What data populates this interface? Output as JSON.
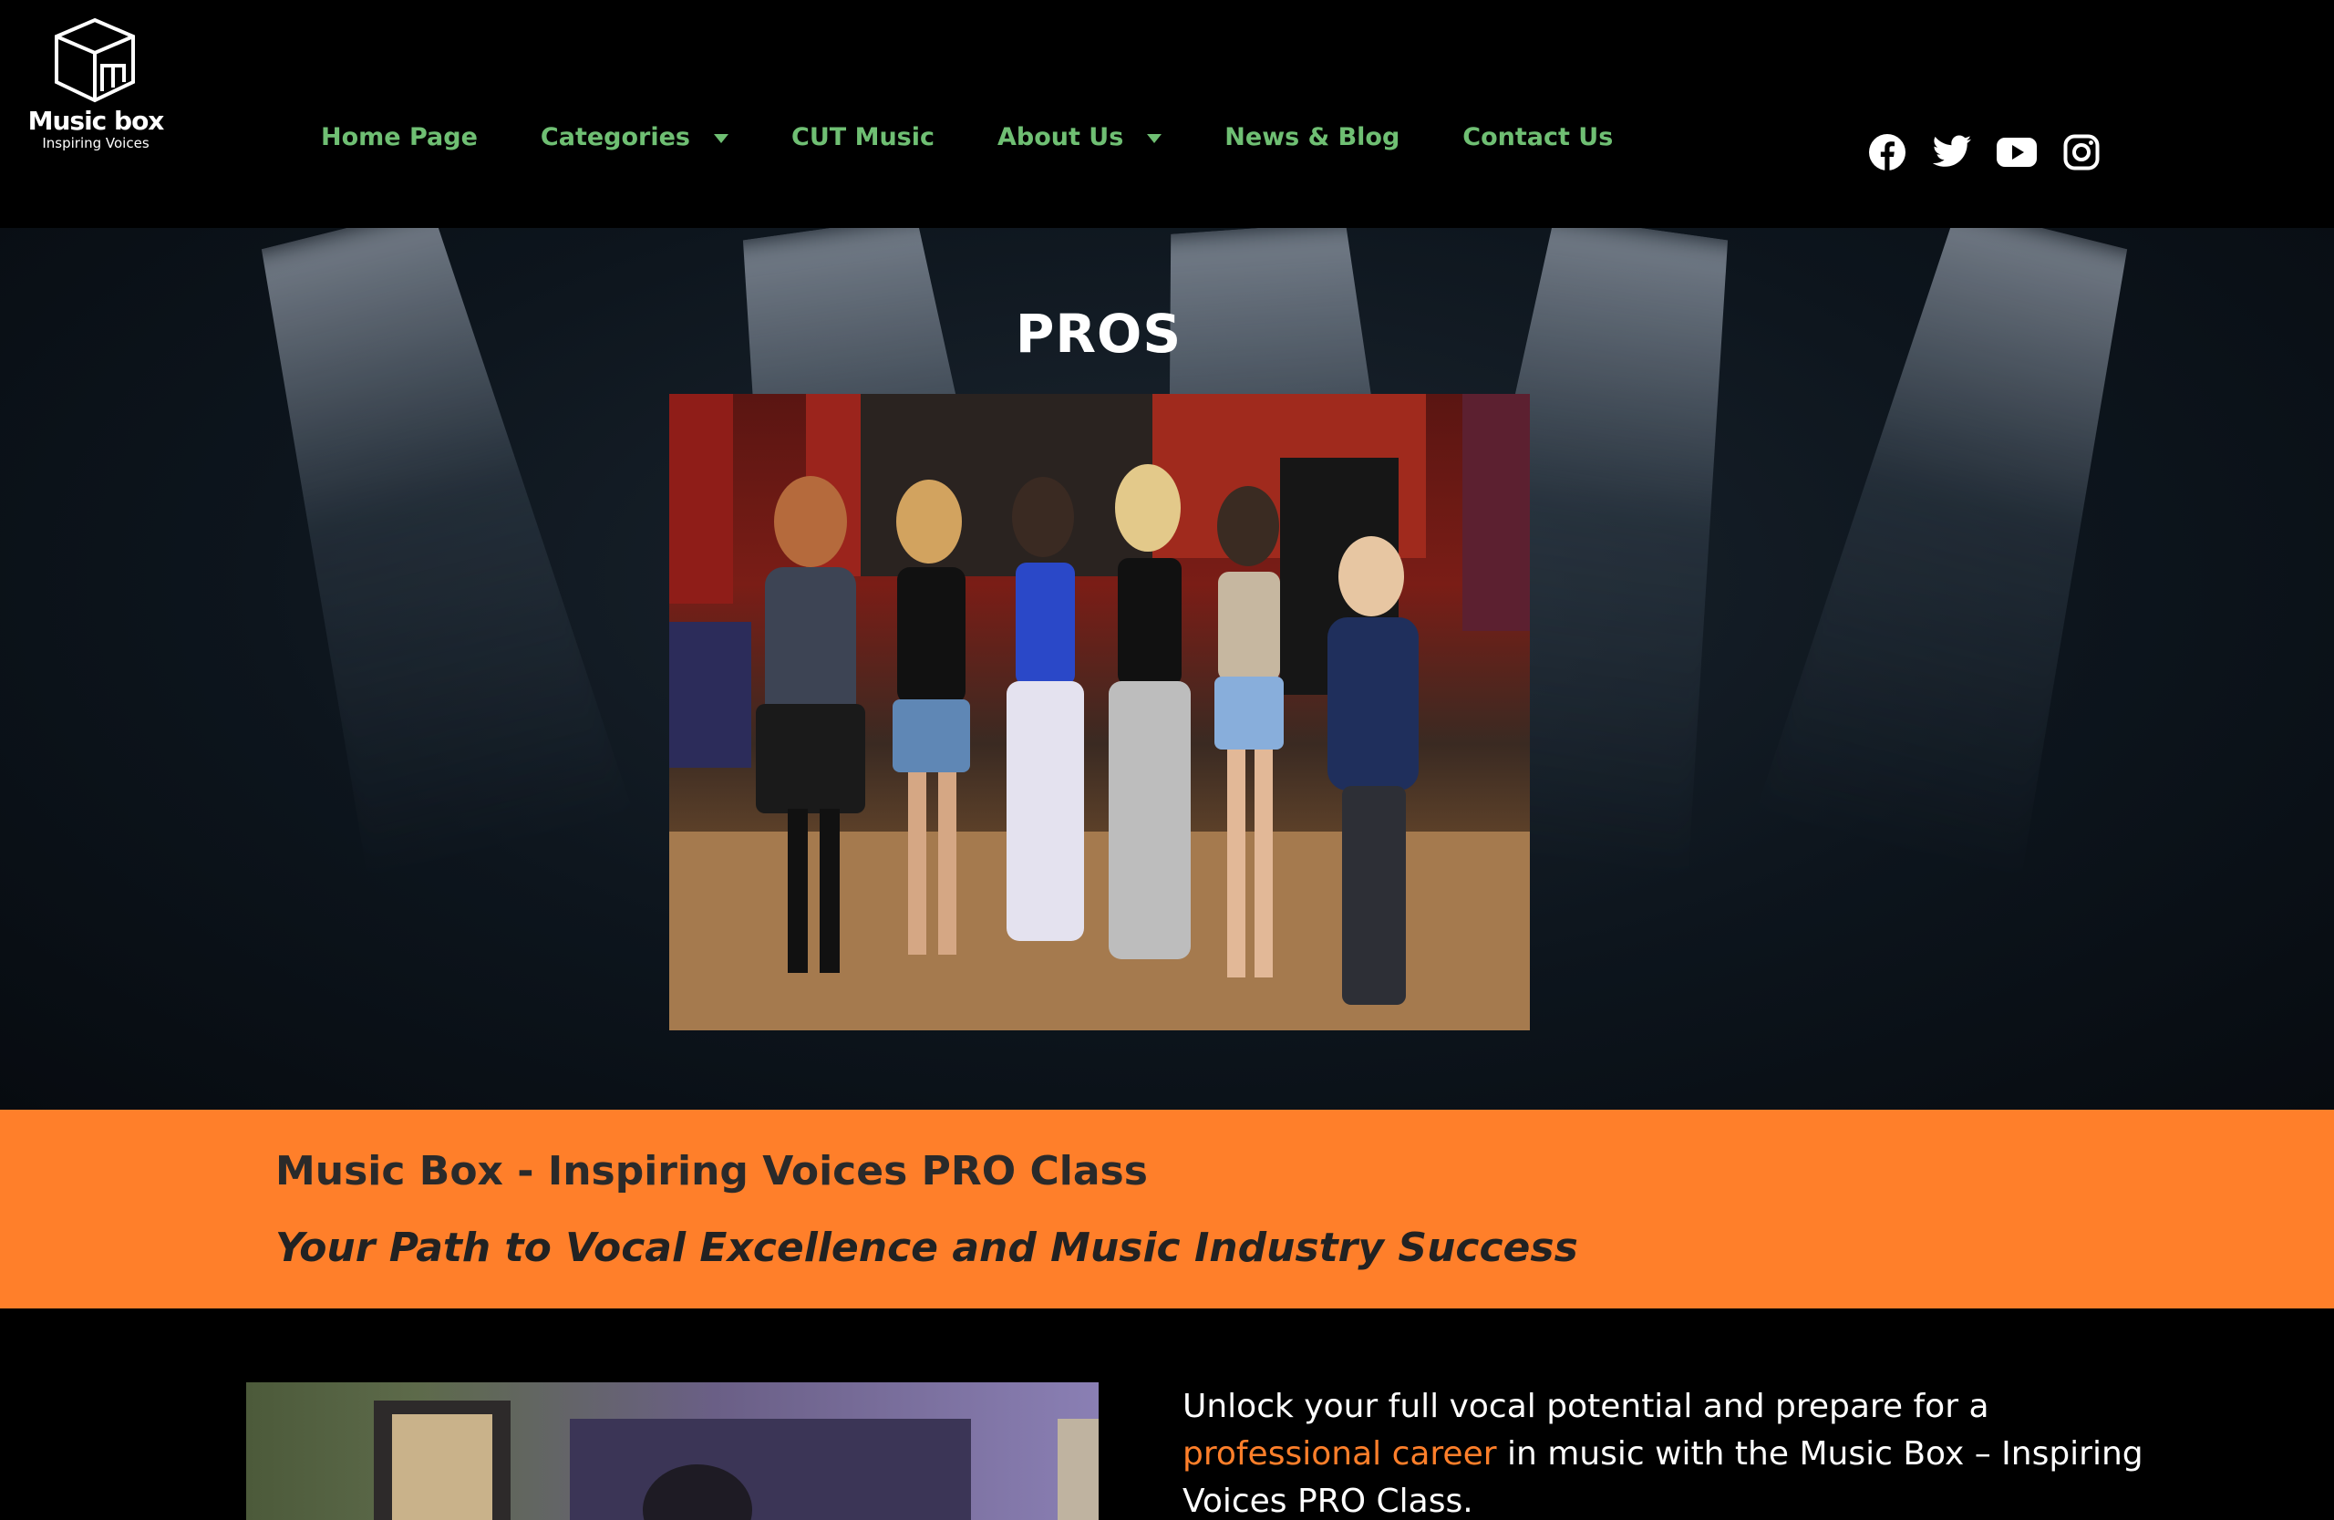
{
  "logo": {
    "brand": "Music box",
    "tagline": "Inspiring Voices"
  },
  "nav": {
    "items": [
      {
        "label": "Home Page",
        "dropdown": false
      },
      {
        "label": "Categories",
        "dropdown": true
      },
      {
        "label": "CUT Music",
        "dropdown": false
      },
      {
        "label": "About Us",
        "dropdown": true
      },
      {
        "label": "News & Blog",
        "dropdown": false
      },
      {
        "label": "Contact Us",
        "dropdown": false
      }
    ],
    "color": "#6fbf73"
  },
  "social": {
    "icons": [
      "facebook-icon",
      "twitter-icon",
      "youtube-icon",
      "instagram-icon"
    ]
  },
  "hero": {
    "title": "PROS"
  },
  "band": {
    "title": "Music Box - Inspiring Voices PRO Class",
    "subtitle": "Your Path to Vocal Excellence and Music Industry Success",
    "color": "#ff7f2a"
  },
  "intro": {
    "text_before": "Unlock your full vocal potential and prepare for a ",
    "link": "professional career",
    "text_after": " in music with the Music Box – Inspiring Voices PRO Class."
  }
}
